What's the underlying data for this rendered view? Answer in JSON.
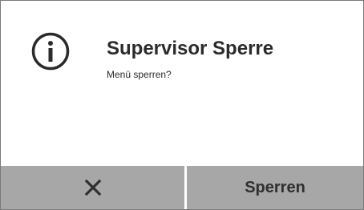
{
  "dialog": {
    "icon": "info-circle-icon",
    "title": "Supervisor Sperre",
    "message": "Menü sperren?"
  },
  "buttons": {
    "cancel_icon": "close-x-icon",
    "lock_label": "Sperren"
  },
  "colors": {
    "button_background": "#a7a7a7",
    "text": "#2b2b2b",
    "border": "#7a7a7a"
  }
}
